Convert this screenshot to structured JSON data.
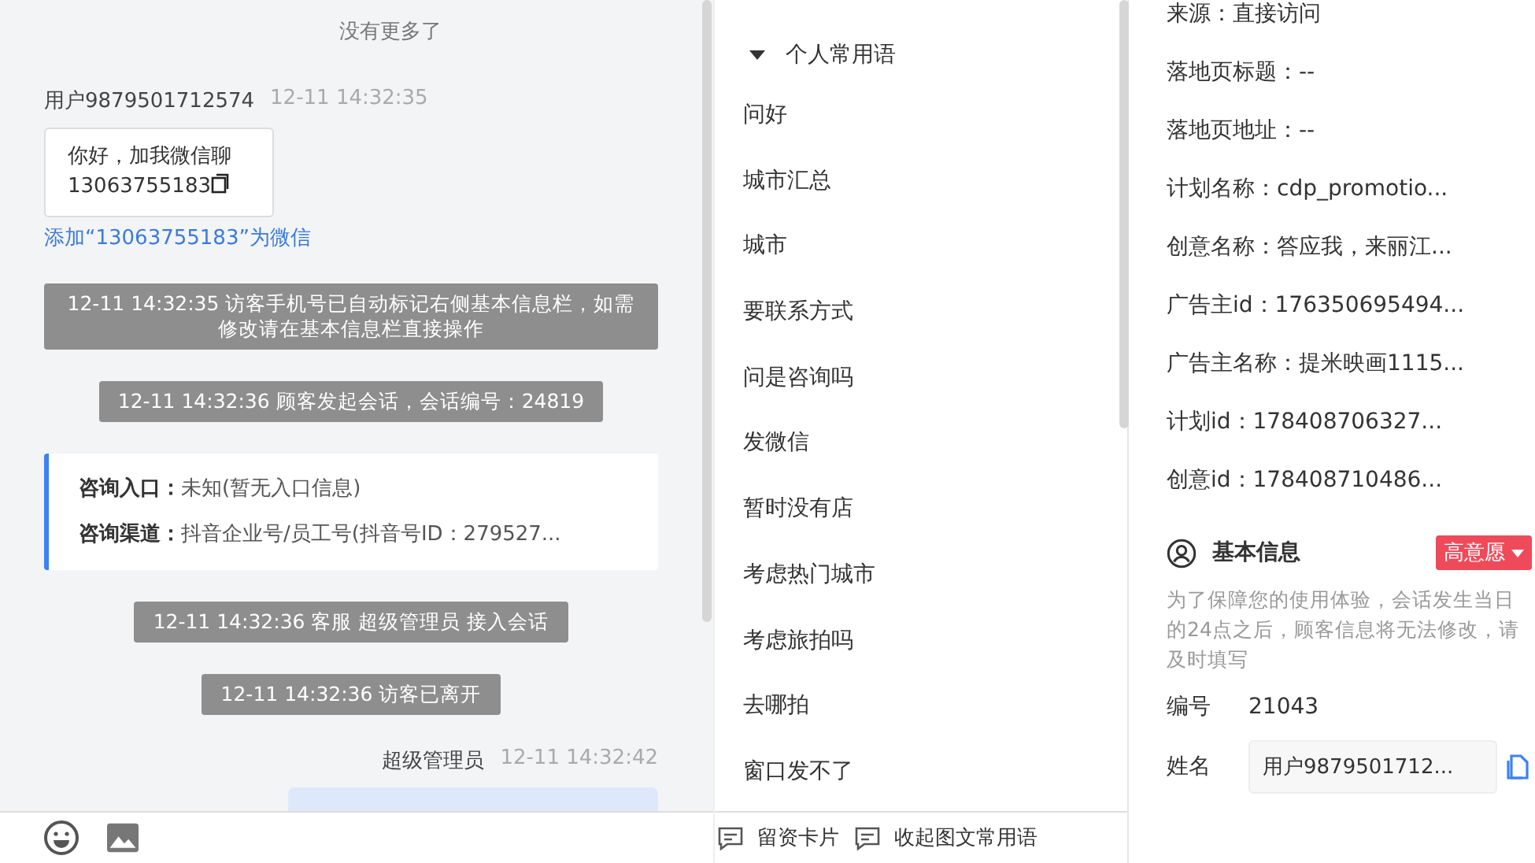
{
  "chat": {
    "load_more": "没有更多了",
    "messages": [
      {
        "kind": "visitor",
        "sender": "用户9879501712574",
        "time": "12-11 14:32:35",
        "text": "你好，加我微信聊13063755183",
        "action": "添加“13063755183”为微信"
      },
      {
        "kind": "system",
        "text": "12-11 14:32:35 访客手机号已自动标记右侧基本信息栏，如需修改请在基本信息栏直接操作"
      },
      {
        "kind": "system",
        "text": "12-11 14:32:36 顾客发起会话，会话编号：24819"
      },
      {
        "kind": "info",
        "rows": [
          {
            "label": "咨询入口：",
            "value": "未知(暂无入口信息)"
          },
          {
            "label": "咨询渠道：",
            "value": "抖音企业号/员工号(抖音号ID：279527..."
          }
        ]
      },
      {
        "kind": "system",
        "text": "12-11 14:32:36 客服 超级管理员 接入会话"
      },
      {
        "kind": "system",
        "text": "12-11 14:32:36 访客已离开"
      },
      {
        "kind": "agent",
        "sender": "超级管理员",
        "time": "12-11 14:32:42"
      }
    ]
  },
  "phrases": {
    "group": {
      "label": "个人常用语",
      "expanded": true
    },
    "items": [
      "问好",
      "城市汇总",
      "城市",
      "要联系方式",
      "问是咨询吗",
      "发微信",
      "暂时没有店",
      "考虑热门城市",
      "考虑旅拍吗",
      "去哪拍",
      "窗口发不了"
    ],
    "footer": [
      "留资卡片",
      "收起图文常用语"
    ]
  },
  "details": [
    "来源：直接访问",
    "落地页标题：--",
    "落地页地址：--",
    "计划名称：cdp_promotio...",
    "创意名称：答应我，来丽江...",
    "广告主id：176350695494...",
    "广告主名称：提米映画1115...",
    "计划id：178408706327...",
    "创意id：178408710486..."
  ],
  "basic_info": {
    "title": "基本信息",
    "tag": "高意愿",
    "note": "为了保障您的使用体验，会话发生当日的24点之后，顾客信息将无法修改，请及时填写",
    "fields": [
      {
        "kind": "text",
        "label": "编号",
        "value": "21043"
      },
      {
        "kind": "input",
        "label": "姓名",
        "value": "用户9879501712..."
      }
    ]
  }
}
